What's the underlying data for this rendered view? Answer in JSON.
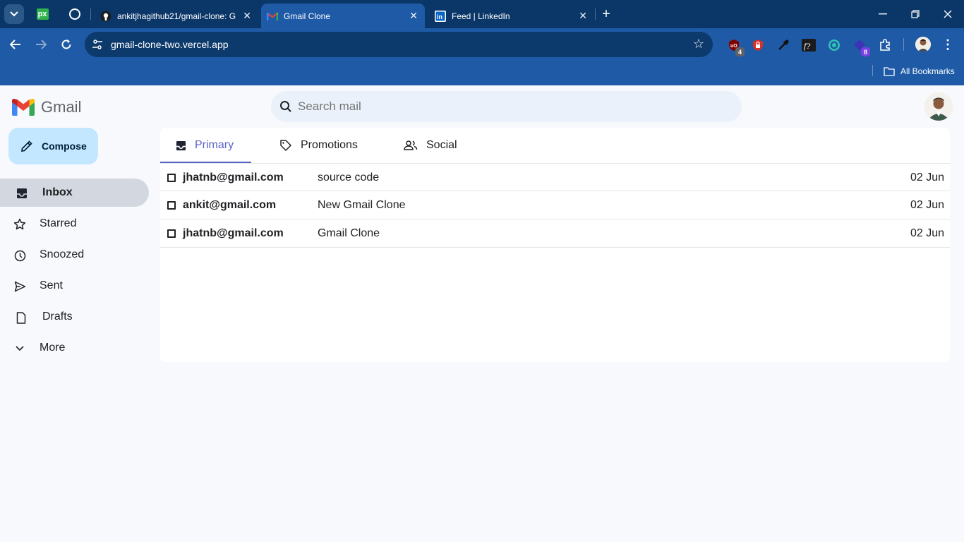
{
  "browser": {
    "tabs": [
      {
        "title": "ankitjhagithub21/gmail-clone: G"
      },
      {
        "title": "Gmail Clone"
      },
      {
        "title": "Feed | LinkedIn"
      }
    ],
    "pinned": [
      {
        "label": "px"
      }
    ],
    "url": "gmail-clone-two.vercel.app",
    "extensions": [
      {
        "badge": "4"
      },
      {
        "badge": "8"
      }
    ],
    "bookmarks_label": "All Bookmarks",
    "colors": {
      "tabbar": "#0b3768",
      "toolbar": "#1e5aa6"
    }
  },
  "app": {
    "wordmark": "Gmail",
    "search_placeholder": "Search mail",
    "compose_label": "Compose",
    "nav": [
      {
        "label": "Inbox",
        "icon": "inbox-icon",
        "active": true
      },
      {
        "label": "Starred",
        "icon": "star-icon"
      },
      {
        "label": "Snoozed",
        "icon": "clock-icon"
      },
      {
        "label": "Sent",
        "icon": "send-icon"
      },
      {
        "label": "Drafts",
        "icon": "draft-icon"
      },
      {
        "label": "More",
        "icon": "chevron-down-icon"
      }
    ],
    "tabs": [
      {
        "label": "Primary",
        "icon": "inbox-icon",
        "active": true
      },
      {
        "label": "Promotions",
        "icon": "tag-icon"
      },
      {
        "label": "Social",
        "icon": "people-icon"
      }
    ],
    "emails": [
      {
        "from": "jhatnb@gmail.com",
        "subject": "source code",
        "date": "02 Jun"
      },
      {
        "from": "ankit@gmail.com",
        "subject": "New Gmail Clone",
        "date": "02 Jun"
      },
      {
        "from": "jhatnb@gmail.com",
        "subject": "Gmail Clone",
        "date": "02 Jun"
      }
    ],
    "colors": {
      "accent": "#5b63c9",
      "compose_bg": "#c2e7ff",
      "active_nav": "#d3d7e0"
    }
  }
}
